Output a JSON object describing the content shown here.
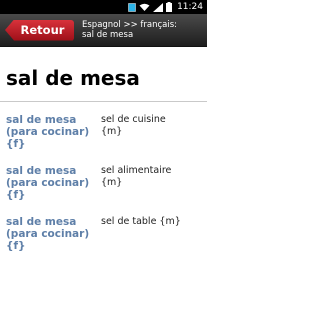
{
  "status_bar": {
    "clock": "11:24",
    "icons": [
      "sim-icon",
      "wifi-icon",
      "signal-icon",
      "battery-icon"
    ]
  },
  "topbar": {
    "back_label": "Retour",
    "title_line1": "Espagnol >> français:",
    "title_line2": "sal de mesa",
    "colors": {
      "back": "#c01e28",
      "bar": "#2a2a2a"
    }
  },
  "headword": "sal de mesa",
  "entries": [
    {
      "source_line1": "sal de mesa",
      "source_line2": "(para cocinar)",
      "source_line3": "{f}",
      "target": "sel de cuisine",
      "target_line2": "{m}"
    },
    {
      "source_line1": "sal de mesa",
      "source_line2": "(para cocinar)",
      "source_line3": "{f}",
      "target": "sel alimentaire",
      "target_line2": "{m}"
    },
    {
      "source_line1": "sal de mesa",
      "source_line2": "(para cocinar)",
      "source_line3": "{f}",
      "target": "sel de table {m}",
      "target_line2": ""
    }
  ]
}
